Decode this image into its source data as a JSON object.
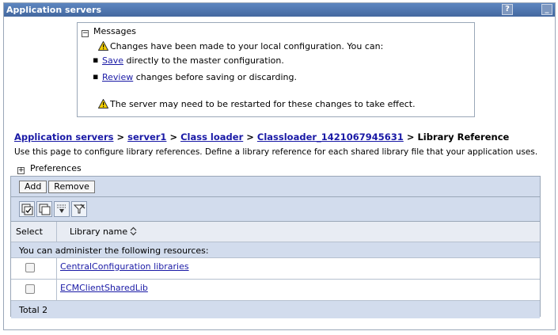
{
  "panel": {
    "title": "Application servers",
    "help_label": "?",
    "minimize_label": "_"
  },
  "messages": {
    "heading": "Messages",
    "toggle": "−",
    "changes_text": "Changes have been made to your local configuration. You can:",
    "save_link": "Save",
    "save_rest": " directly to the master configuration.",
    "review_link": "Review",
    "review_rest": " changes before saving or discarding.",
    "restart_text": "The server may need to be restarted for these changes to take effect."
  },
  "breadcrumb": {
    "items": [
      "Application servers",
      "server1",
      "Class loader",
      "Classloader_1421067945631"
    ],
    "separator": " > ",
    "current": "Library Reference"
  },
  "description": "Use this page to configure library references. Define a library reference for each shared library file that your application uses.",
  "preferences": {
    "label": "Preferences",
    "toggle": "+"
  },
  "table": {
    "buttons": {
      "add": "Add",
      "remove": "Remove"
    },
    "icons": [
      "select-all-icon",
      "deselect-all-icon",
      "show-filter-icon",
      "clear-filter-icon"
    ],
    "columns": {
      "select": "Select",
      "name": "Library name"
    },
    "admin_text": "You can administer the following resources:",
    "rows": [
      {
        "name": "CentralConfiguration libraries"
      },
      {
        "name": "ECMClientSharedLib"
      }
    ],
    "total": "Total 2"
  }
}
